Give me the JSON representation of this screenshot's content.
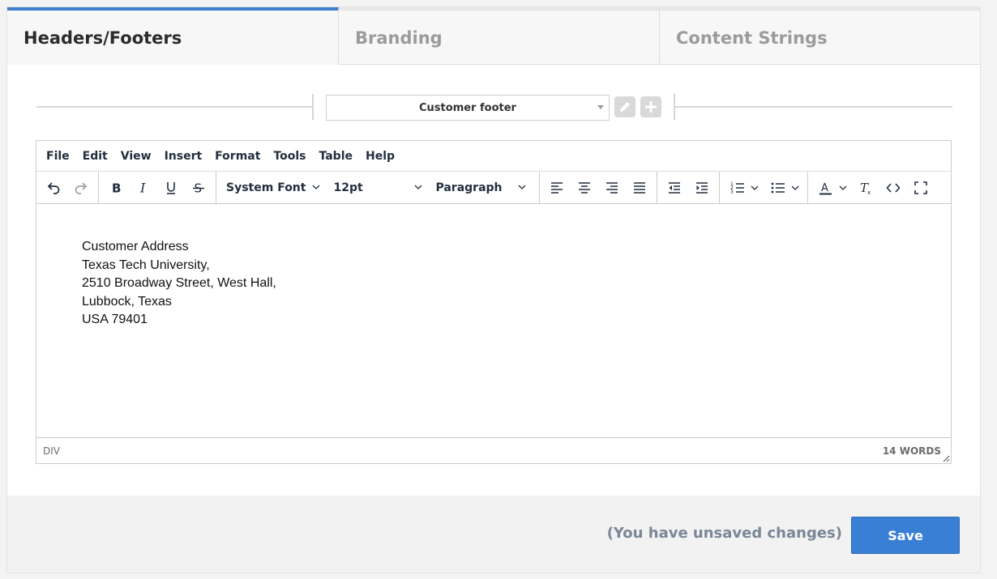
{
  "tabs": [
    {
      "label": "Headers/Footers",
      "active": true
    },
    {
      "label": "Branding",
      "active": false
    },
    {
      "label": "Content Strings",
      "active": false
    }
  ],
  "selector": {
    "value": "Customer footer"
  },
  "editor": {
    "menu": [
      "File",
      "Edit",
      "View",
      "Insert",
      "Format",
      "Tools",
      "Table",
      "Help"
    ],
    "toolbar": {
      "font_family": "System Font",
      "font_size": "12pt",
      "block_format": "Paragraph"
    },
    "content_lines": [
      "Customer Address",
      "Texas Tech University,",
      "2510 Broadway Street, West Hall,",
      "Lubbock, Texas",
      "USA 79401"
    ],
    "status_path": "DIV",
    "word_count": "14 WORDS"
  },
  "footer": {
    "unsaved_text": "(You have unsaved changes)",
    "save_label": "Save"
  },
  "colors": {
    "accent": "#3d7fcc",
    "save_button": "#3a7fd6"
  }
}
